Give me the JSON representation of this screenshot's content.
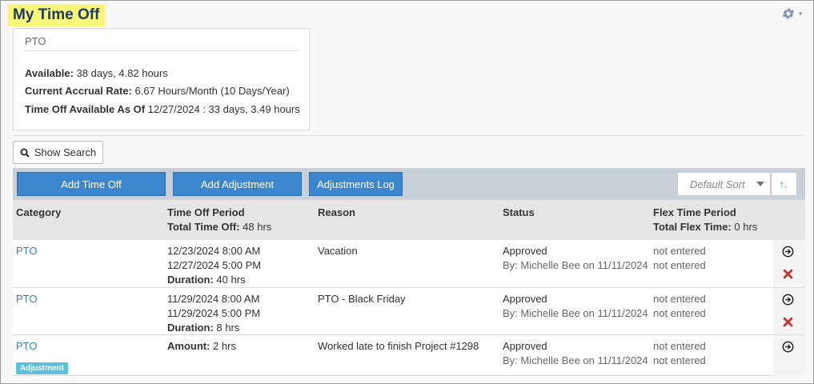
{
  "header": {
    "title": "My Time Off",
    "settings_icon": "gear-icon"
  },
  "pto_summary": {
    "title": "PTO",
    "available_label": "Available:",
    "available_value": " 38 days, 4.82 hours",
    "accrual_label": "Current Accrual Rate:",
    "accrual_value": " 6.67 Hours/Month (10 Days/Year)",
    "asof_label": "Time Off Available As Of",
    "asof_value": " 12/27/2024 : 33 days, 3.49 hours"
  },
  "search": {
    "label": "Show Search",
    "icon": "search-icon"
  },
  "toolbar": {
    "add_time_off": "Add Time Off",
    "add_adjustment": "Add Adjustment",
    "adjustments_log": "Adjustments Log",
    "sort_placeholder": "Default Sort",
    "sort_direction_icon": "sort-arrows-icon"
  },
  "table": {
    "headers": {
      "category": "Category",
      "period": "Time Off Period",
      "period_total_label": "Total Time Off:",
      "period_total_value": " 48 hrs",
      "reason": "Reason",
      "status": "Status",
      "flex": "Flex Time Period",
      "flex_total_label": "Total Flex Time:",
      "flex_total_value": " 0 hrs"
    },
    "rows": [
      {
        "category": "PTO",
        "start": "12/23/2024 8:00 AM",
        "end": "12/27/2024 5:00 PM",
        "duration_label": "Duration:",
        "duration_value": " 40 hrs",
        "reason": "Vacation",
        "status": "Approved",
        "status_by": "By: Michelle Bee on 11/11/2024",
        "flex1": "not entered",
        "flex2": "not entered"
      },
      {
        "category": "PTO",
        "start": "11/29/2024 8:00 AM",
        "end": "11/29/2024 5:00 PM",
        "duration_label": "Duration:",
        "duration_value": " 8 hrs",
        "reason": "PTO - Black Friday",
        "status": "Approved",
        "status_by": "By: Michelle Bee on 11/11/2024",
        "flex1": "not entered",
        "flex2": "not entered"
      },
      {
        "category": "PTO",
        "badge": "Adjustment",
        "amount_label": "Amount:",
        "amount_value": " 2 hrs",
        "reason": "Worked late to finish Project #1298",
        "status": "Approved",
        "status_by": "By: Michelle Bee on 11/11/2024",
        "flex1": "not entered",
        "flex2": "not entered"
      }
    ]
  },
  "colors": {
    "title_highlight": "#f7f57a",
    "primary_button": "#3c86cd",
    "link": "#3a7fc0",
    "badge": "#5bc0de",
    "delete": "#c9302c"
  }
}
